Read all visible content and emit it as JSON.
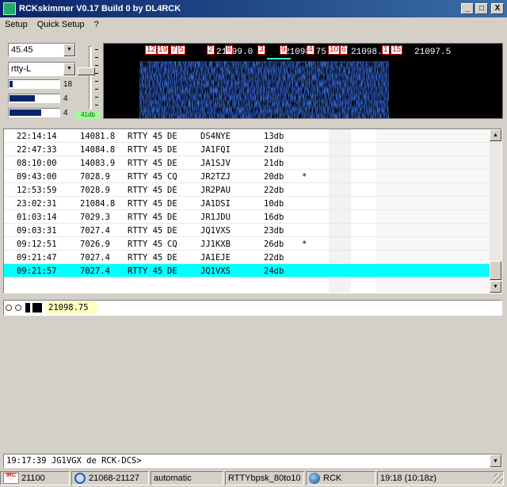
{
  "window": {
    "title": "RCKskimmer V0.17 Build 0 by DL4RCK",
    "btn_min": "_",
    "btn_max": "□",
    "btn_close": "X"
  },
  "menu": [
    {
      "label": "Setup"
    },
    {
      "label": "Quick Setup"
    },
    {
      "label": "?"
    }
  ],
  "controls": {
    "baud": "45.45",
    "mode": "rtty-L",
    "levels": [
      {
        "value": "18",
        "fill": 0.06
      },
      {
        "value": "4",
        "fill": 0.5
      },
      {
        "value": "4",
        "fill": 0.62
      }
    ],
    "db_readout": "41db"
  },
  "waterfall": {
    "freq_labels": [
      "21099.0",
      "21098.75",
      "21098.0",
      "21097.5"
    ],
    "spots": [
      "12",
      "19",
      "7",
      "5",
      "2",
      "8",
      "3",
      "9",
      "4",
      "10",
      "6",
      "1",
      "15"
    ]
  },
  "decodes": {
    "rows": [
      {
        "time": "22:14:14",
        "freq": "14081.8",
        "mode": "RTTY 45",
        "de": "DE",
        "call": "DS4NYE",
        "db": "13db",
        "flag": ""
      },
      {
        "time": "22:47:33",
        "freq": "14084.8",
        "mode": "RTTY 45",
        "de": "DE",
        "call": "JA1FQI",
        "db": "21db",
        "flag": ""
      },
      {
        "time": "08:10:00",
        "freq": "14083.9",
        "mode": "RTTY 45",
        "de": "DE",
        "call": "JA1SJV",
        "db": "21db",
        "flag": ""
      },
      {
        "time": "09:43:00",
        "freq": "7028.9",
        "mode": "RTTY 45",
        "de": "CQ",
        "call": "JR2TZJ",
        "db": "20db",
        "flag": "*"
      },
      {
        "time": "12:53:59",
        "freq": "7028.9",
        "mode": "RTTY 45",
        "de": "DE",
        "call": "JR2PAU",
        "db": "22db",
        "flag": ""
      },
      {
        "time": "23:02:31",
        "freq": "21084.8",
        "mode": "RTTY 45",
        "de": "DE",
        "call": "JA1DSI",
        "db": "10db",
        "flag": ""
      },
      {
        "time": "01:03:14",
        "freq": "7029.3",
        "mode": "RTTY 45",
        "de": "DE",
        "call": "JR1JDU",
        "db": "16db",
        "flag": ""
      },
      {
        "time": "09:03:31",
        "freq": "7027.4",
        "mode": "RTTY 45",
        "de": "DE",
        "call": "JQ1VXS",
        "db": "23db",
        "flag": ""
      },
      {
        "time": "09:12:51",
        "freq": "7026.9",
        "mode": "RTTY 45",
        "de": "CQ",
        "call": "JJ1KXB",
        "db": "26db",
        "flag": "*"
      },
      {
        "time": "09:21:47",
        "freq": "7027.4",
        "mode": "RTTY 45",
        "de": "DE",
        "call": "JA1EJE",
        "db": "22db",
        "flag": ""
      },
      {
        "time": "09:21:57",
        "freq": "7027.4",
        "mode": "RTTY 45",
        "de": "DE",
        "call": "JQ1VXS",
        "db": "24db",
        "flag": ""
      }
    ],
    "selected_index": 10
  },
  "tuned_freq": "21098.75",
  "command_line": "19:17:39 JG1VGX de RCK-DCS>",
  "status": {
    "irc_icon_text": "IRC",
    "freq": "21100",
    "range": "21068-21127",
    "agc": "automatic",
    "decoder": "RTTYbpsk_80to10",
    "skimmer": "RCK",
    "clock": "19:18 (10:18z)"
  },
  "colors": {
    "title_bar": "#0a246a",
    "selected_row": "#00ffff",
    "waterfall_signal": "#1e3cff",
    "spot_text": "#c00000",
    "db_readout_bg": "#9cff9c"
  }
}
